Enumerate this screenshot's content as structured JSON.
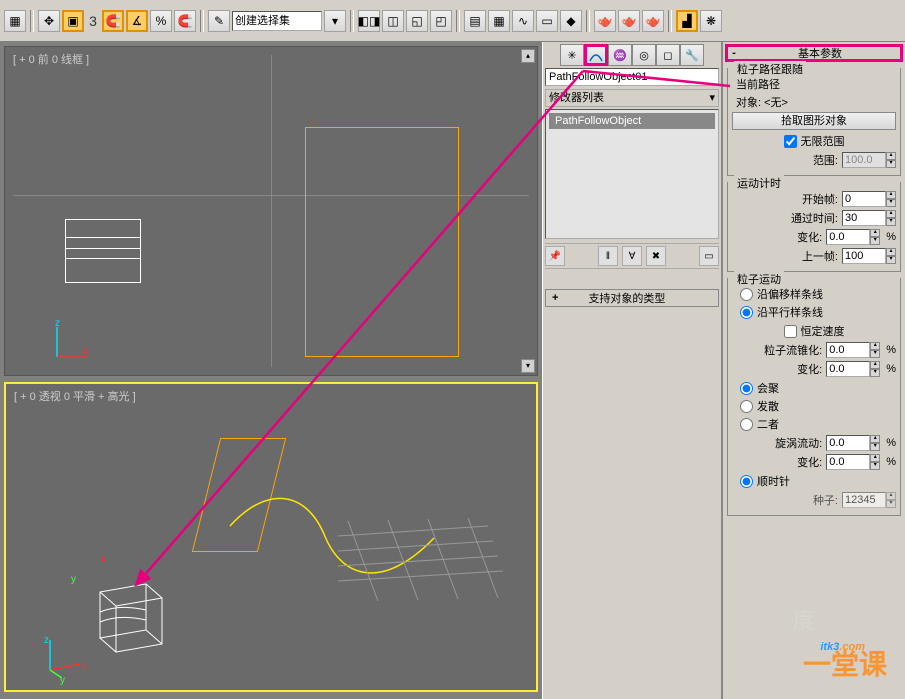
{
  "toolbar": {
    "num_label": "3",
    "dropdown_label": "创建选择集",
    "percent": "%"
  },
  "viewports": {
    "top_label": "[ + 0 前 0 线框 ]",
    "bottom_label": "[ + 0 透视 0 平滑 + 高光 ]",
    "axes": {
      "z": "z",
      "x": "x",
      "y": "y"
    }
  },
  "mid_panel": {
    "object_name": "PathFollowObject01",
    "mod_list_label": "修改器列表",
    "mod_item": "PathFollowObject",
    "rollout_support": "支持对象的类型",
    "plus_minus": "+"
  },
  "right_panel": {
    "basic_params": "基本参数",
    "pm": "-",
    "group_path": {
      "legend": "粒子路径跟随",
      "current_path": "当前路径",
      "object_label": "对象: <无>",
      "pick_btn": "拾取图形对象",
      "unlimited_cb": "无限范围",
      "range_lbl": "范围:",
      "range_val": "100.0"
    },
    "group_timing": {
      "legend": "运动计时",
      "start_lbl": "开始帧:",
      "start_val": "0",
      "travel_lbl": "通过时间:",
      "travel_val": "30",
      "var_lbl": "变化:",
      "var_val": "0.0",
      "var_unit": "%",
      "last_lbl": "上一帧:",
      "last_val": "100"
    },
    "group_motion": {
      "legend": "粒子运动",
      "radio_offset": "沿偏移样条线",
      "radio_parallel": "沿平行样条线",
      "const_speed_cb": "恒定速度",
      "taper_lbl": "粒子流锥化:",
      "taper_val": "0.0",
      "taper_unit": "%",
      "var2_lbl": "变化:",
      "var2_val": "0.0",
      "var2_unit": "%",
      "radio_converge": "会聚",
      "radio_diverge": "发散",
      "radio_both": "二者",
      "swirl_lbl": "旋涡流动:",
      "swirl_val": "0.0",
      "swirl_unit": "%",
      "var3_lbl": "变化:",
      "var3_val": "0.0",
      "var3_unit": "%",
      "radio_cw": "顺时针",
      "seed_lbl": "种子:",
      "seed_val": "12345"
    }
  },
  "watermarks": {
    "itk3": "itk3",
    "com": ".com",
    "ydk": "一堂课",
    "baidu": "度"
  }
}
